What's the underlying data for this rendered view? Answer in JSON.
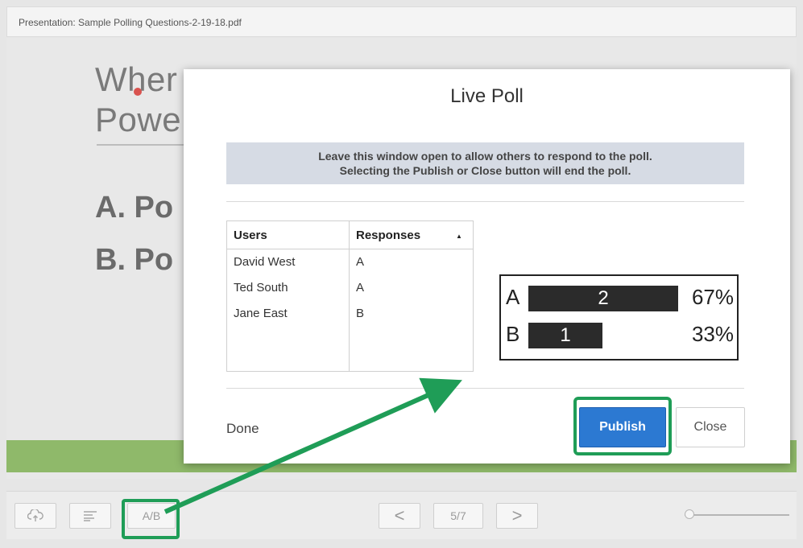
{
  "window": {
    "title": "Presentation: Sample Polling Questions-2-19-18.pdf"
  },
  "slide": {
    "title_line1": "Wher",
    "title_line2": "Powe",
    "option_a": "A. Po",
    "option_b": "B. Po"
  },
  "toolbar": {
    "ab_label": "A/B",
    "prev_label": "<",
    "page_label": "5/7",
    "next_label": ">"
  },
  "modal": {
    "title": "Live Poll",
    "info_line1": "Leave this window open to allow others to respond to the poll.",
    "info_line2": "Selecting the Publish or Close button will end the poll.",
    "table": {
      "headers": [
        "Users",
        "Responses"
      ],
      "rows": [
        {
          "user": "David West",
          "response": "A"
        },
        {
          "user": "Ted South",
          "response": "A"
        },
        {
          "user": "Jane East",
          "response": "B"
        }
      ]
    },
    "results": [
      {
        "letter": "A",
        "count": "2",
        "percent": "67%",
        "fraction": 0.67
      },
      {
        "letter": "B",
        "count": "1",
        "percent": "33%",
        "fraction": 0.33
      }
    ],
    "done_label": "Done",
    "publish_label": "Publish",
    "close_label": "Close"
  },
  "colors": {
    "highlight": "#1f9d57",
    "publish": "#2c79d2",
    "bar": "#2b2b2b",
    "slide_band": "#8fb96a"
  }
}
